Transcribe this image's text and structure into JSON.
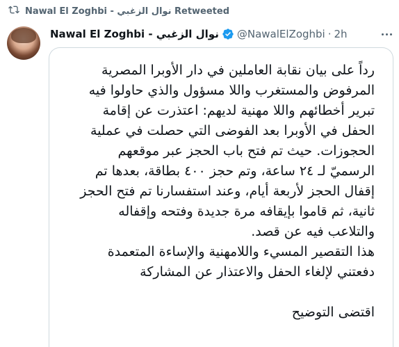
{
  "retweet": {
    "text": "Nawal El Zoghbi - نوال الزغبي Retweeted"
  },
  "tweet": {
    "author_name": "Nawal El Zoghbi - نوال الزغبي",
    "handle": "@NawalElZoghbi",
    "separator": "·",
    "time": "2h",
    "verified_color": "#1d9bf0",
    "lines": [
      "رداً على بيان نقابة العاملين في دار الأوبرا المصرية",
      "المرفوض والمستغرب واللا مسؤول والذي حاولوا فيه",
      "تبرير أخطائهم واللا مهنية لديهم: اعتذرت عن إقامة",
      "الحفل في الأوبرا بعد الفوضى التي حصلت في عملية",
      "الحجوزات. حيث تم فتح باب الحجز عبر موقعهم",
      "الرسميّ لـ ٢٤ ساعة، وتم حجز ٤٠٠ بطاقة، بعدها تم",
      "إقفال الحجز لأربعة أيام، وعند استفسارنا تم فتح الحجز",
      "ثانية، ثم قاموا بإيقافه مرة جديدة وفتحه وإقفاله",
      "والتلاعب فيه عن قصد.",
      "هذا التقصير المسيء واللامهنية والإساءة المتعمدة",
      "دفعتني لإلغاء الحفل والاعتذار عن المشاركة"
    ],
    "signoff": "اقتضى التوضيح"
  }
}
